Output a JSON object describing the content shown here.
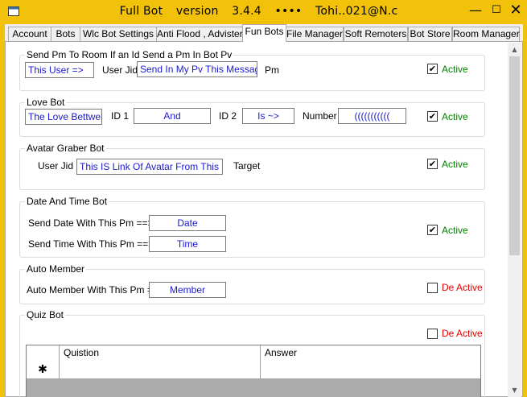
{
  "window": {
    "title": "Full Bot",
    "version_label": "version",
    "version": "3.4.4",
    "separator": "••••",
    "user": "Tohi..021@N.c",
    "minimize": "—",
    "maximize": "☐",
    "close": "✕"
  },
  "tabs": [
    {
      "label": "Account"
    },
    {
      "label": "Bots"
    },
    {
      "label": "Wlc Bot Settings"
    },
    {
      "label": "Anti Flood , Advister"
    },
    {
      "label": "Fun Bots",
      "active": true
    },
    {
      "label": "File Manager"
    },
    {
      "label": "Soft Remoters"
    },
    {
      "label": "Bot Store"
    },
    {
      "label": "Room Manager"
    }
  ],
  "send_pm": {
    "title": "Send Pm To Room If an Id Send a Pm In Bot Pv",
    "user_value": "This User =>",
    "user_jid_label": "User Jid",
    "message_value": "Send In My Pv This Message",
    "pm_label": "Pm",
    "active_checked": true,
    "active_label": "Active"
  },
  "love_bot": {
    "title": "Love Bot",
    "text_value": "The Love Bettwen",
    "id1_label": "ID 1",
    "and_value": "And",
    "id2_label": "ID 2",
    "is_value": "Is ~>",
    "number_label": "Number",
    "number_value": "(((((((((((",
    "active_checked": true,
    "active_label": "Active"
  },
  "avatar_bot": {
    "title": "Avatar Graber Bot",
    "user_jid_label": "User Jid",
    "value": "This IS Link Of Avatar From This Id ~",
    "target_label": "Target",
    "active_checked": true,
    "active_label": "Active"
  },
  "date_time_bot": {
    "title": "Date And Time Bot",
    "date_label": "Send Date With This Pm ==>",
    "date_value": "Date",
    "time_label": "Send Time With This Pm ==>",
    "time_value": "Time",
    "active_checked": true,
    "active_label": "Active"
  },
  "auto_member": {
    "title": "Auto Member",
    "label": "Auto Member With This Pm ==>",
    "value": "Member",
    "active_checked": false,
    "active_label": "De Active"
  },
  "quiz_bot": {
    "title": "Quiz Bot",
    "active_checked": false,
    "active_label": "De Active",
    "columns": [
      "Quistion",
      "Answer"
    ],
    "new_row_marker": "✱"
  },
  "colors": {
    "title_bar": "#f2c20a",
    "active_green": "#008000",
    "inactive_red": "#e00000",
    "textbox_text": "#1a1acd"
  }
}
